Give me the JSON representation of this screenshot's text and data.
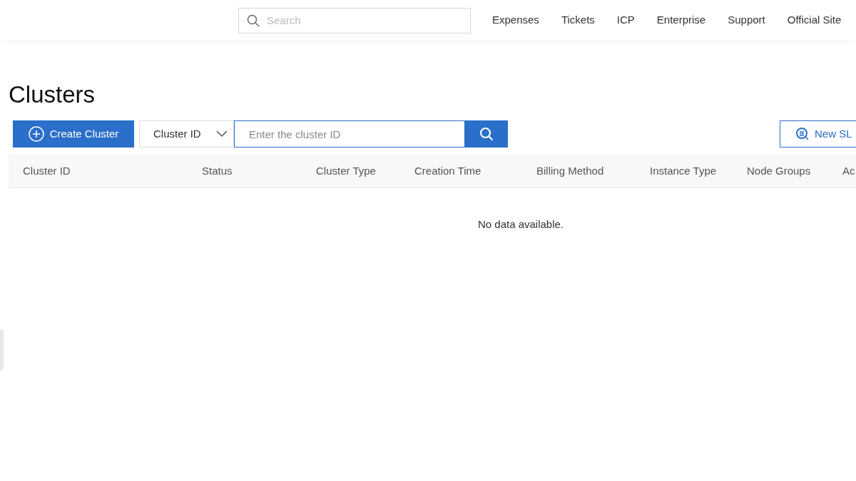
{
  "top_nav": {
    "search": {
      "placeholder": "Search"
    },
    "links": [
      "Expenses",
      "Tickets",
      "ICP",
      "Enterprise",
      "Support",
      "Official Site"
    ]
  },
  "page": {
    "title": "Clusters"
  },
  "toolbar": {
    "create_button": "Create Cluster",
    "filter_select": "Cluster ID",
    "search": {
      "placeholder": "Enter the cluster ID"
    },
    "right_button": "New SL"
  },
  "table": {
    "columns": [
      "Cluster ID",
      "Status",
      "Cluster Type",
      "Creation Time",
      "Billing Method",
      "Instance Type",
      "Node Groups",
      "Ac"
    ],
    "empty_text": "No data available."
  }
}
